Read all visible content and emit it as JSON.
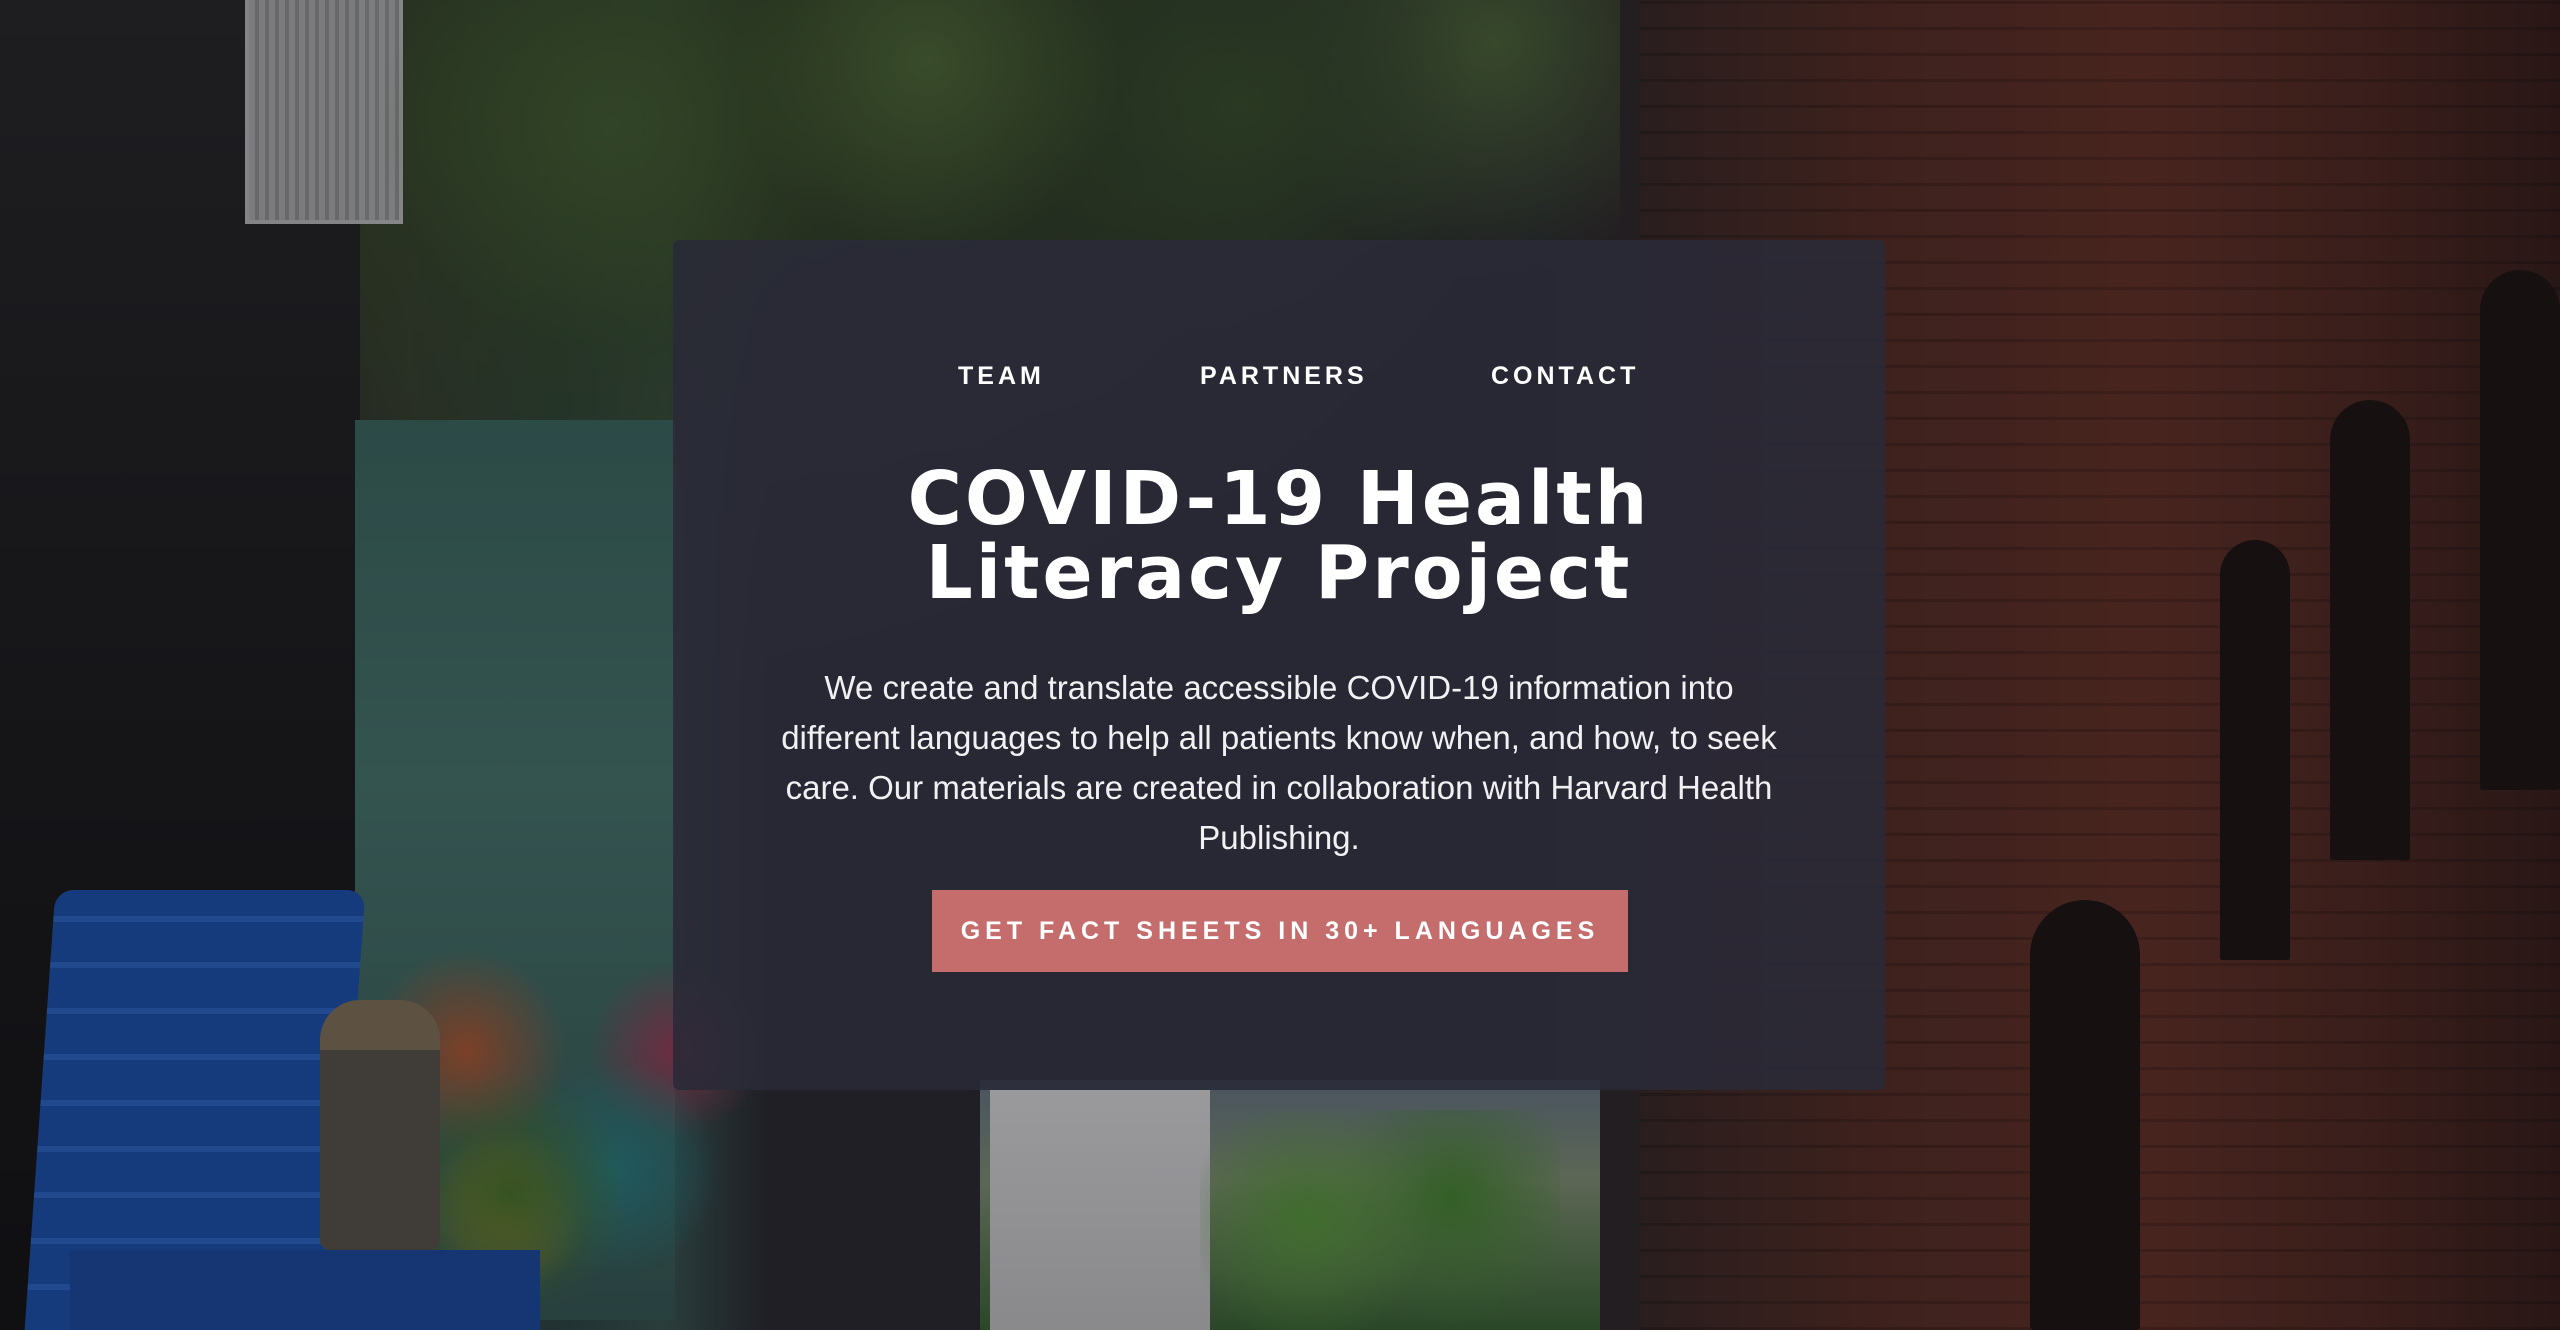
{
  "nav": {
    "items": [
      {
        "label": "TEAM"
      },
      {
        "label": "PARTNERS"
      },
      {
        "label": "CONTACT"
      }
    ]
  },
  "hero": {
    "title_line1": "COVID-19 Health",
    "title_line2": "Literacy Project",
    "description": "We create and translate accessible COVID-19 information into different languages to help all patients know when, and how, to seek care. Our materials are created in collaboration with Harvard Health Publishing.",
    "cta_label": "GET FACT SHEETS IN 30+ LANGUAGES"
  },
  "colors": {
    "panel": "#2a2a38",
    "cta": "#c56d6d",
    "text": "#ffffff"
  }
}
